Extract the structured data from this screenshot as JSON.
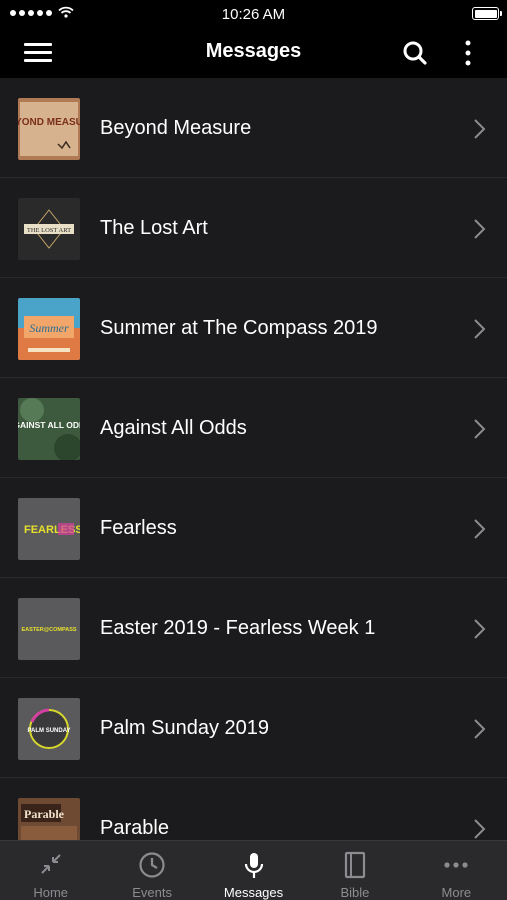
{
  "status_bar": {
    "time": "10:26 AM"
  },
  "nav": {
    "title": "Messages"
  },
  "messages": [
    {
      "title": "Beyond Measure",
      "thumb_text": "BEYOND MEASURE"
    },
    {
      "title": "The Lost Art",
      "thumb_text": "THE LOST ART"
    },
    {
      "title": "Summer at The Compass 2019",
      "thumb_text": "Summer"
    },
    {
      "title": "Against All Odds",
      "thumb_text": "AGAINST ALL ODDS"
    },
    {
      "title": "Fearless",
      "thumb_text": "FEARLESS"
    },
    {
      "title": "Easter 2019 - Fearless Week 1",
      "thumb_text": "EASTER@COMPASS"
    },
    {
      "title": "Palm Sunday 2019",
      "thumb_text": "PALM SUNDAY"
    },
    {
      "title": "Parable",
      "thumb_text": "Parable"
    }
  ],
  "tabs": [
    {
      "label": "Home",
      "icon": "collapse-arrows-icon",
      "active": false
    },
    {
      "label": "Events",
      "icon": "clock-icon",
      "active": false
    },
    {
      "label": "Messages",
      "icon": "microphone-icon",
      "active": true
    },
    {
      "label": "Bible",
      "icon": "book-icon",
      "active": false
    },
    {
      "label": "More",
      "icon": "more-dots-icon",
      "active": false
    }
  ],
  "colors": {
    "background": "#1b1b1d",
    "header": "#000000",
    "tab_bar": "#2a2a2c",
    "inactive": "#8c8c90"
  }
}
